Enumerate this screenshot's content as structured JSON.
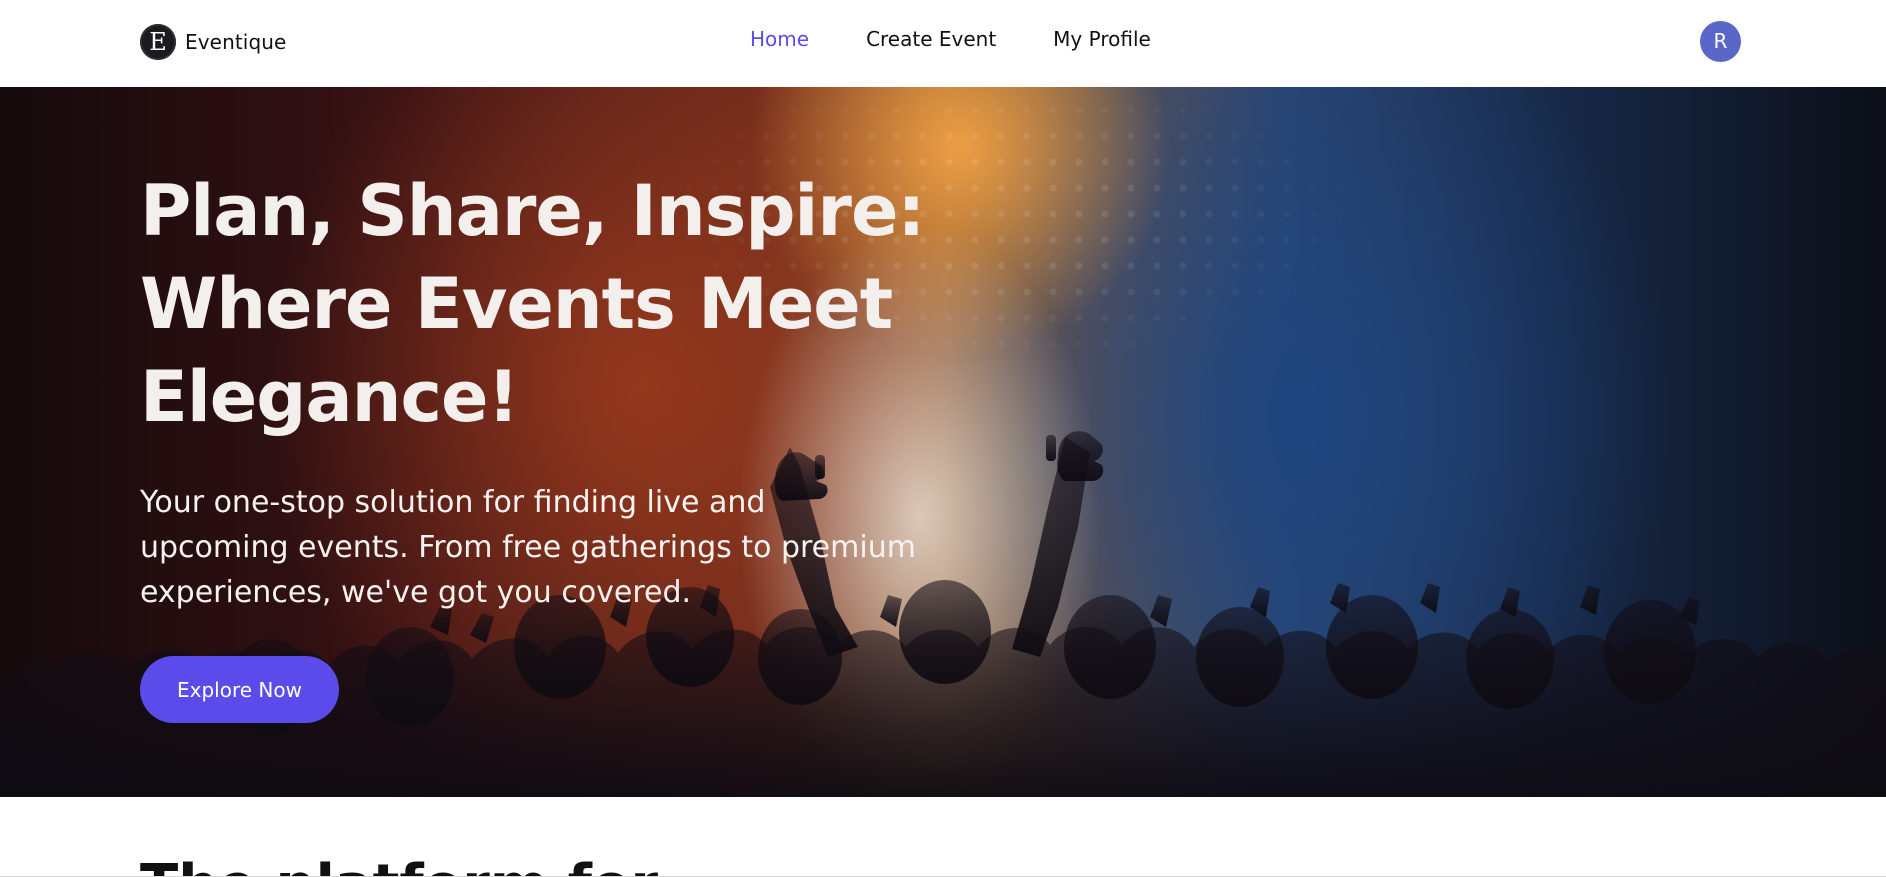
{
  "navbar": {
    "brand": {
      "logo_letter": "E",
      "name": "Eventique",
      "logo_icon": "brand-logo-icon"
    },
    "links": [
      {
        "label": "Home",
        "active": true
      },
      {
        "label": "Create Event",
        "active": false
      },
      {
        "label": "My Profile",
        "active": false
      }
    ],
    "avatar_initial": "R"
  },
  "hero": {
    "title_lines": [
      "Plan, Share, Inspire:",
      "Where Events Meet",
      "Elegance!"
    ],
    "subtitle_lines": [
      "Your one-stop solution for finding live and",
      "upcoming events. From free gatherings to premium",
      "experiences, we've got you covered."
    ],
    "cta_label": "Explore Now"
  },
  "next_section": {
    "heading": "The platform for"
  },
  "colors": {
    "accent": "#5b4bea",
    "avatar": "#5a67c7",
    "nav_text": "#111111",
    "hero_text": "#f3efed"
  }
}
